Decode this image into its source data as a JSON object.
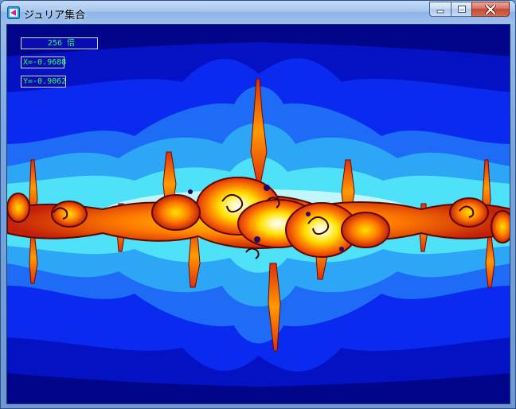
{
  "window": {
    "title": "ジュリア集合",
    "controls": {
      "minimize_icon": "minimize-icon",
      "maximize_icon": "maximize-icon",
      "close_icon": "close-icon"
    }
  },
  "overlay": {
    "zoom_label": "256 倍",
    "x_label": "X=-0.9688",
    "y_label": "Y=-0.9062"
  },
  "colors": {
    "background_deep": "#00058a",
    "band_blue": "#0a2af0",
    "band_mid": "#1e6cf5",
    "band_light": "#2ea6f6",
    "band_cyan": "#4fe1f7",
    "fractal_dark": "#8a1000",
    "fractal_red": "#e0300a",
    "fractal_orange": "#ff8a00",
    "fractal_yellow": "#ffe200",
    "info_text": "#33ff66"
  }
}
